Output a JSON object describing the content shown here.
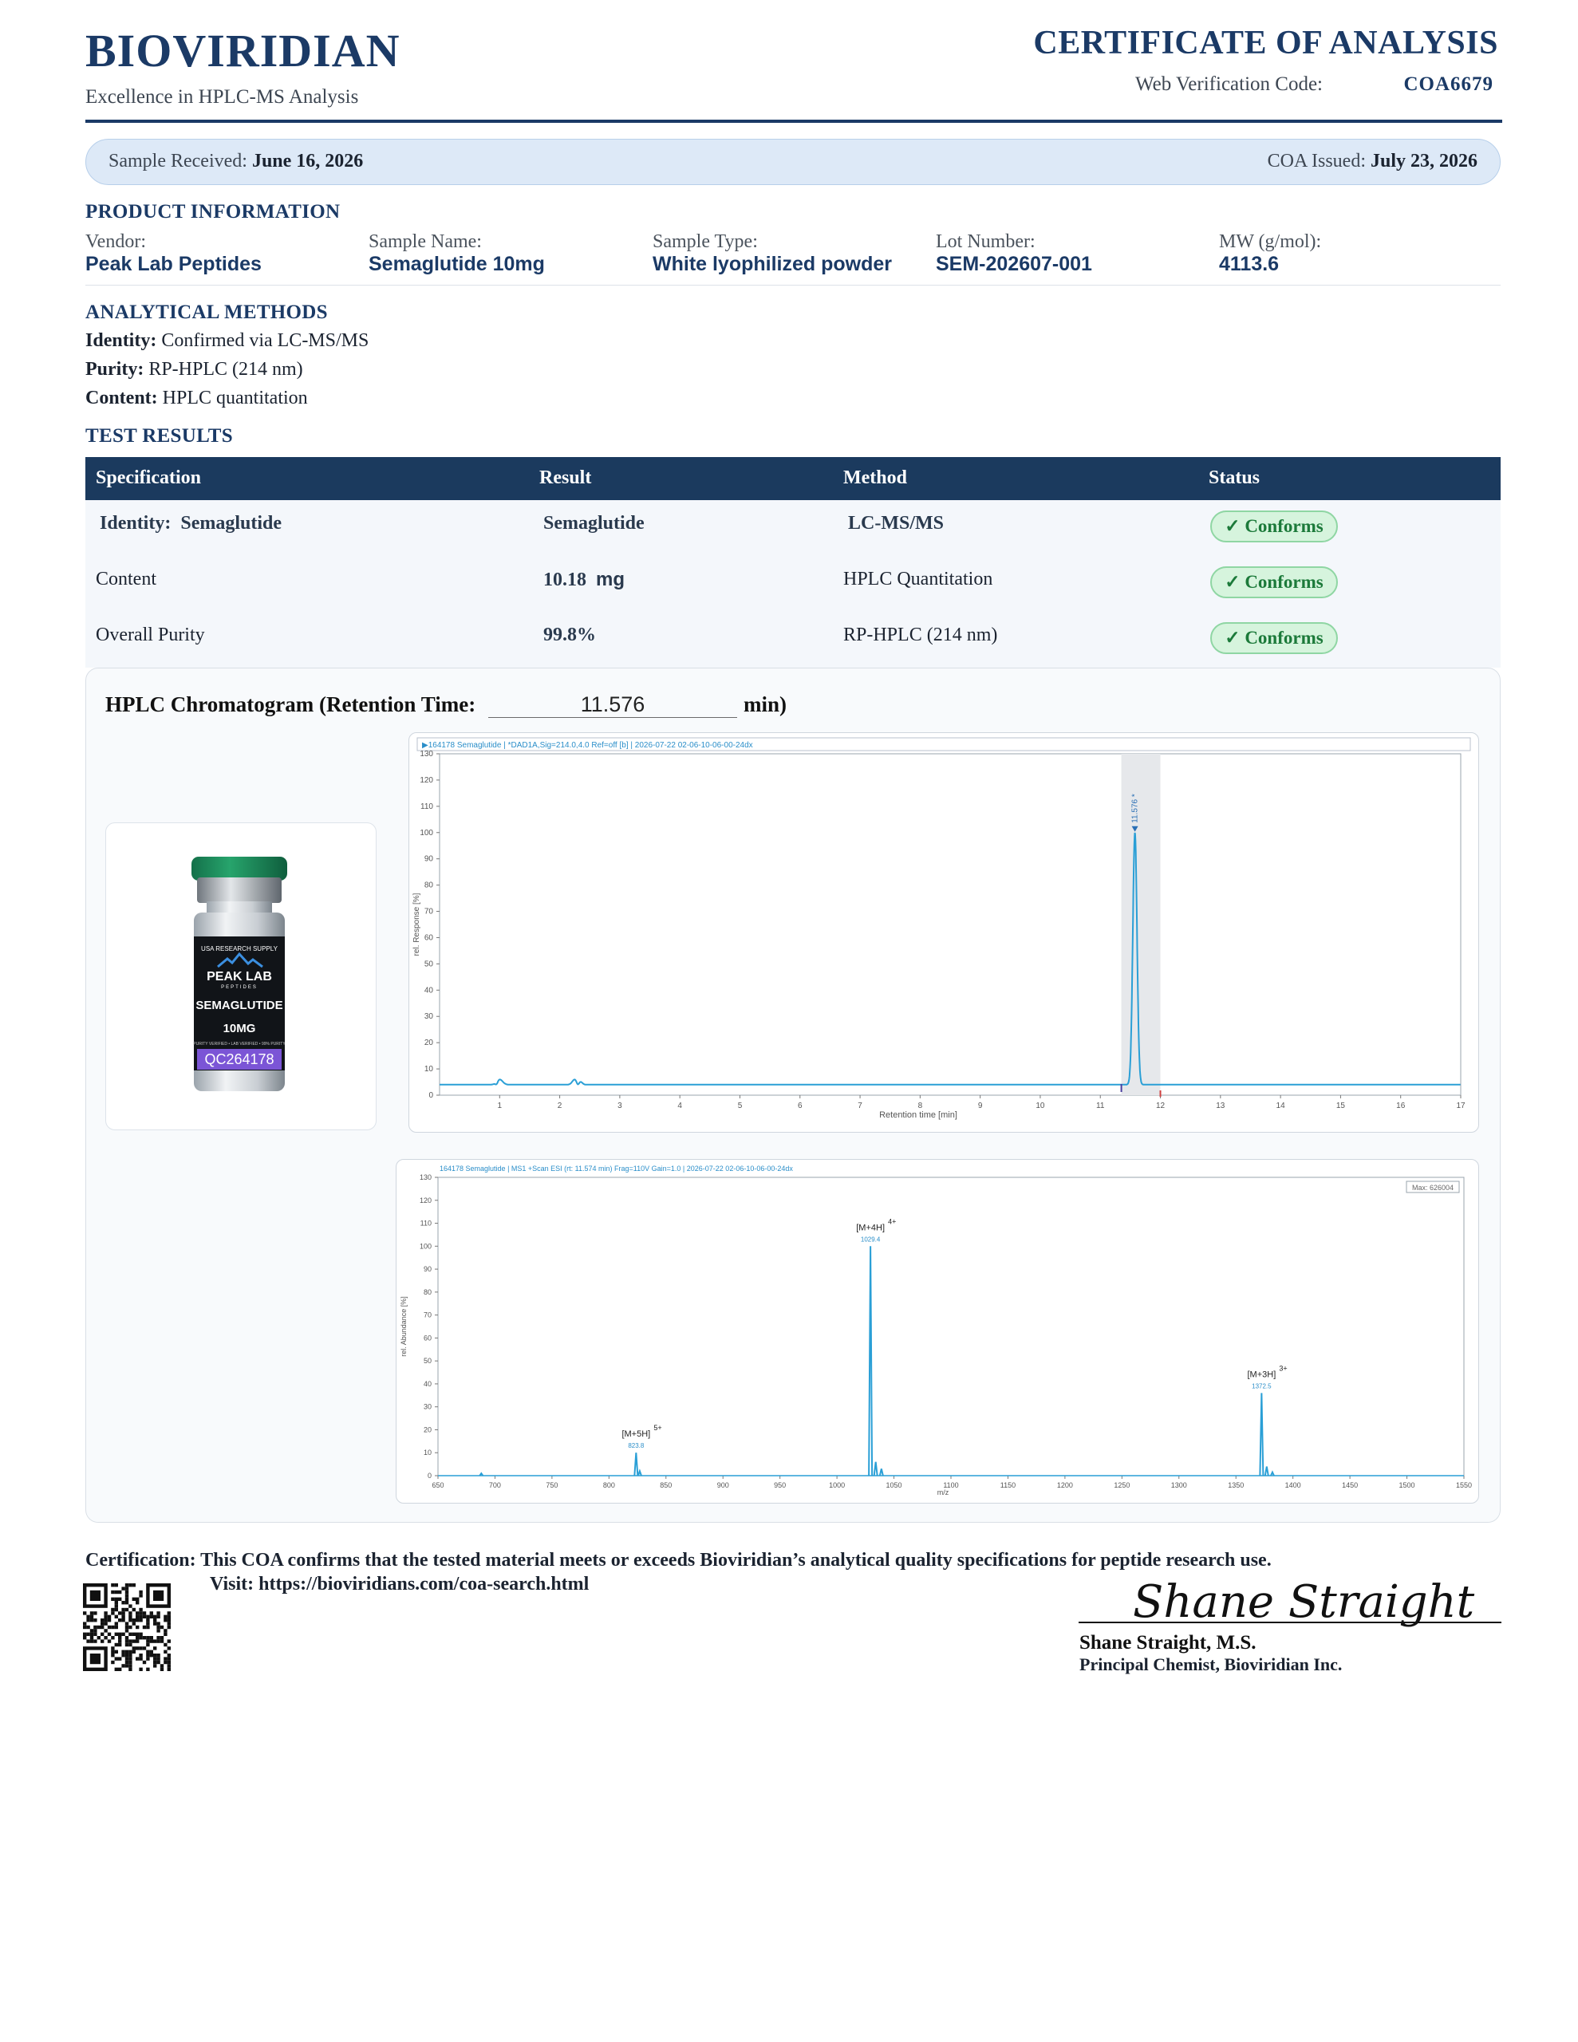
{
  "header": {
    "brand": "BIOVIRIDIAN",
    "tagline": "Excellence in HPLC-MS Analysis",
    "doc_title": "CERTIFICATE OF ANALYSIS",
    "verification_label": "Web Verification Code:",
    "verification_code": "COA6679"
  },
  "dates": {
    "received_label": "Sample Received:",
    "received_value": "June 16, 2026",
    "issued_label": "COA Issued:",
    "issued_value": "July 23, 2026"
  },
  "product": {
    "heading": "PRODUCT INFORMATION",
    "fields": [
      {
        "label": "Vendor:",
        "value": "Peak Lab Peptides"
      },
      {
        "label": "Sample Name:",
        "value": "Semaglutide 10mg"
      },
      {
        "label": "Sample Type:",
        "value": "White lyophilized powder"
      },
      {
        "label": "Lot Number:",
        "value": "SEM-202607-001"
      },
      {
        "label": "MW (g/mol):",
        "value": "4113.6"
      }
    ]
  },
  "methods": {
    "heading": "ANALYTICAL METHODS",
    "lines": [
      {
        "label": "Identity:",
        "value": "Confirmed via LC-MS/MS"
      },
      {
        "label": "Purity:",
        "value": "RP-HPLC (214 nm)"
      },
      {
        "label": "Content:",
        "value": "HPLC quantitation"
      }
    ]
  },
  "results": {
    "heading": "TEST RESULTS",
    "columns": [
      "Specification",
      "Result",
      "Method",
      "Status"
    ],
    "rows": [
      {
        "spec_label": "Identity:",
        "spec_value": "Semaglutide",
        "result": "Semaglutide",
        "result_unit": "",
        "method": "LC-MS/MS",
        "status": "Conforms"
      },
      {
        "spec_label": "Content",
        "spec_value": "",
        "result": "10.18",
        "result_unit": "mg",
        "method": "HPLC Quantitation",
        "status": "Conforms"
      },
      {
        "spec_label": "Overall Purity",
        "spec_value": "",
        "result": "99.8%",
        "result_unit": "",
        "method": "RP-HPLC (214 nm)",
        "status": "Conforms"
      }
    ],
    "check_glyph": "✓"
  },
  "chromatogram": {
    "title": "HPLC Chromatogram (Retention Time:",
    "retention_time": "11.576",
    "title_end": "min)"
  },
  "vial": {
    "top_text": "USA RESEARCH SUPPLY",
    "brand": "PEAK LAB",
    "brand_sub": "PEPTIDES",
    "product": "SEMAGLUTIDE",
    "dose": "10MG",
    "fine_print": "PURITY VERIFIED • LAB VERIFIED • 99% PURITY",
    "qc_code": "QC264178",
    "cap_color": "#1d8f5c"
  },
  "chart_data": [
    {
      "type": "line",
      "header": "164178 Semaglutide | *DAD1A,Sig=214.0,4.0 Ref=off [b] | 2026-07-22 02-06-10-06-00-24dx",
      "xlabel": "Retention time [min]",
      "ylabel": "rel. Response [%]",
      "xlim": [
        0,
        17
      ],
      "ylim": [
        0,
        130
      ],
      "xticks": [
        1,
        2,
        3,
        4,
        5,
        6,
        7,
        8,
        9,
        10,
        11,
        12,
        13,
        14,
        15,
        16,
        17
      ],
      "yticks": [
        0,
        10,
        20,
        30,
        40,
        50,
        60,
        70,
        80,
        90,
        100,
        110,
        120,
        130
      ],
      "peak_label": "11.576 *",
      "baseline": 4,
      "peaks": [
        {
          "x": 1.0,
          "y": 6,
          "width": 0.05
        },
        {
          "x": 2.25,
          "y": 6,
          "width": 0.04
        },
        {
          "x": 2.35,
          "y": 5,
          "width": 0.03
        },
        {
          "x": 11.576,
          "y": 100,
          "width": 0.035
        }
      ],
      "dips": [
        {
          "x": 0.95,
          "y": 3
        },
        {
          "x": 2.3,
          "y": 3
        }
      ],
      "integration_window": [
        11.35,
        12.0
      ],
      "line_color": "#2a9fd6",
      "grid": false
    },
    {
      "type": "bar",
      "header": "164178 Semaglutide | MS1 +Scan ESI (rt: 11.574 min) Frag=110V Gain=1.0 | 2026-07-22 02-06-10-06-00-24dx",
      "max_label": "Max: 626004",
      "xlabel": "m/z",
      "ylabel": "rel. Abundance [%]",
      "xlim": [
        650,
        1550
      ],
      "ylim": [
        0,
        130
      ],
      "xticks": [
        650,
        700,
        750,
        800,
        850,
        900,
        950,
        1000,
        1050,
        1100,
        1150,
        1200,
        1250,
        1300,
        1350,
        1400,
        1450,
        1500,
        1550
      ],
      "yticks": [
        0,
        10,
        20,
        30,
        40,
        50,
        60,
        70,
        80,
        90,
        100,
        110,
        120,
        130
      ],
      "peaks": [
        {
          "mz": 823.8,
          "y": 10,
          "ion": "[M+5H]",
          "charge": "5+"
        },
        {
          "mz": 1029.4,
          "y": 100,
          "ion": "[M+4H]",
          "charge": "4+"
        },
        {
          "mz": 1372.5,
          "y": 36,
          "ion": "[M+3H]",
          "charge": "3+"
        }
      ],
      "minor_peaks": [
        {
          "mz": 688,
          "y": 1
        },
        {
          "mz": 827,
          "y": 2
        },
        {
          "mz": 1034,
          "y": 6
        },
        {
          "mz": 1039,
          "y": 3
        },
        {
          "mz": 1377,
          "y": 4
        },
        {
          "mz": 1382,
          "y": 1.5
        }
      ],
      "line_color": "#2a9fd6",
      "grid": false
    }
  ],
  "footer": {
    "certification": "Certification: This COA confirms that the tested material meets or exceeds Bioviridian’s analytical quality specifications for peptide research use.",
    "visit": "Visit: https://bioviridians.com/coa-search.html",
    "signature_script": "Shane Straight",
    "signer_name": "Shane Straight, M.S.",
    "signer_title": "Principal Chemist, Bioviridian Inc."
  }
}
